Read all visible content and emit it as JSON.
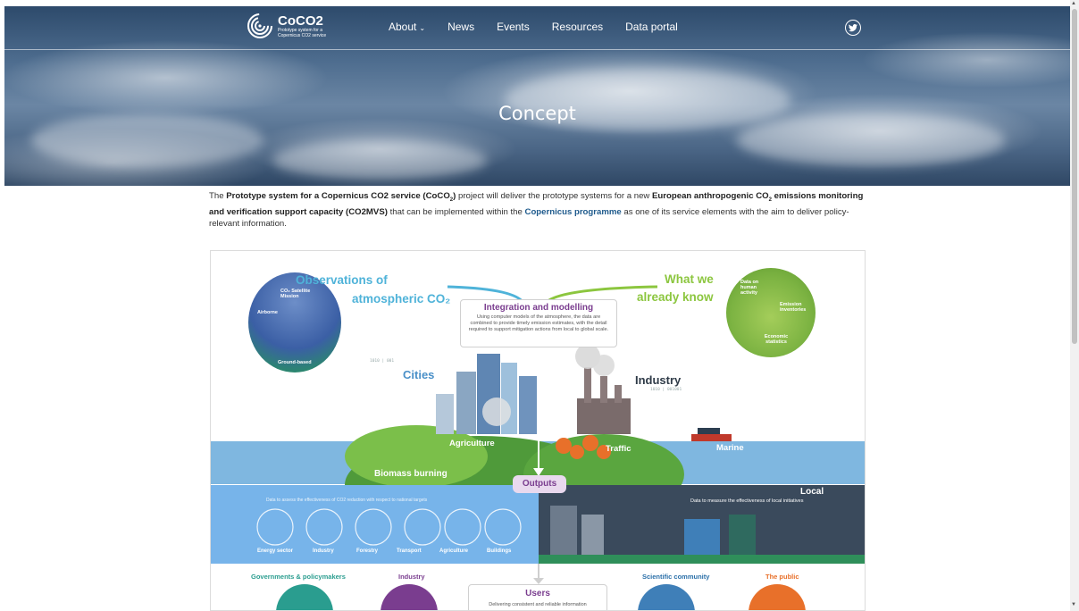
{
  "nav": {
    "logo_title": "CoCO2",
    "logo_sub": "Prototype system for a Copernicus CO2 service",
    "items": [
      {
        "label": "About",
        "has_dropdown": true
      },
      {
        "label": "News"
      },
      {
        "label": "Events"
      },
      {
        "label": "Resources"
      },
      {
        "label": "Data portal"
      }
    ],
    "social_icon": "twitter-icon"
  },
  "hero": {
    "title": "Concept"
  },
  "intro": {
    "p1": "The ",
    "bold1": "Prototype system for a Copernicus CO2 service (CoCO",
    "bold1_sub": "2",
    "bold1_end": ")",
    "p2": " project will deliver the prototype systems for a new ",
    "bold2": "European anthropogenic CO",
    "bold2_sub": "2",
    "bold2_end": " emissions monitoring and verification support capacity (CO2MVS)",
    "p3": " that can be implemented within the ",
    "link": "Copernicus programme",
    "p4": " as one of its service elements with the aim to deliver policy-relevant information."
  },
  "infographic": {
    "obs_title_1": "Observations of",
    "obs_title_2": "atmospheric CO₂",
    "obs_sat": "CO₂ Satellite Mission",
    "obs_air": "Airborne",
    "obs_ground": "Ground-based",
    "know_title_1": "What we",
    "know_title_2": "already know",
    "know_human": "Data on human activity",
    "know_inv": "Emission inventories",
    "know_econ": "Economic statistics",
    "integ_title": "Integration and modelling",
    "integ_text": "Using computer models of the atmosphere, the data are combined to provide timely emission estimates, with the detail required to support mitigation actions from local to global scale.",
    "cities": "Cities",
    "industry": "Industry",
    "agriculture": "Agriculture",
    "traffic": "Traffic",
    "marine": "Marine",
    "biomass": "Biomass burning",
    "outputs": "Outputs",
    "national_text": "Data to assess the effectiveness of CO2 reduction with respect to national targets",
    "sectors": [
      "Energy sector",
      "Industry",
      "Forestry",
      "Transport",
      "Agriculture",
      "Buildings"
    ],
    "local_title": "Local",
    "local_text": "Data to measure the effectiveness of local initiatives",
    "users_title": "Users",
    "users_text": "Delivering consistent and reliable information",
    "gov": "Governments & policymakers",
    "ind_user": "Industry",
    "sci": "Scientific community",
    "public": "The public",
    "binary_a": "1010 | 001",
    "binary_b": "1010 | 001001"
  },
  "colors": {
    "blue_title": "#4fb3d9",
    "green_title": "#8cc63f",
    "purple": "#7a3d8f",
    "outputs_bg": "#e9d9ee",
    "teal": "#2a9d8f",
    "orange": "#e8702a"
  }
}
